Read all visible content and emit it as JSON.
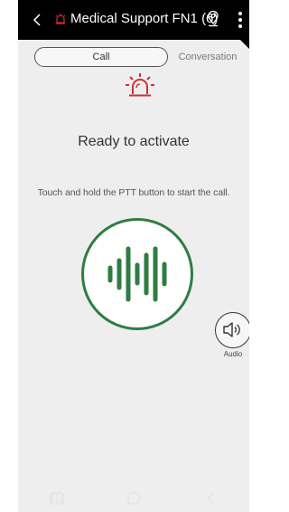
{
  "header": {
    "title": "Medical Support FN1 (6)",
    "back_icon": "chevron-left-icon",
    "alarm_icon": "alarm-icon",
    "location_icon": "location-pin-icon",
    "more_icon": "more-vertical-icon"
  },
  "tabs": [
    {
      "label": "Call",
      "selected": true
    },
    {
      "label": "Conversation",
      "selected": false
    }
  ],
  "main": {
    "status": "Ready to activate",
    "hint": "Touch and hold the PTT button to start the call.",
    "ptt_icon": "soundwave-icon",
    "alarm_icon": "alarm-icon"
  },
  "audio": {
    "label": "Audio",
    "icon": "speaker-icon"
  },
  "colors": {
    "accent_green": "#2e7d42",
    "alarm_red": "#d32f2f",
    "header_bg": "#000000",
    "screen_bg": "#eeeeee"
  },
  "navbar": {
    "items": [
      "recent-apps-icon",
      "home-icon",
      "back-icon"
    ]
  }
}
